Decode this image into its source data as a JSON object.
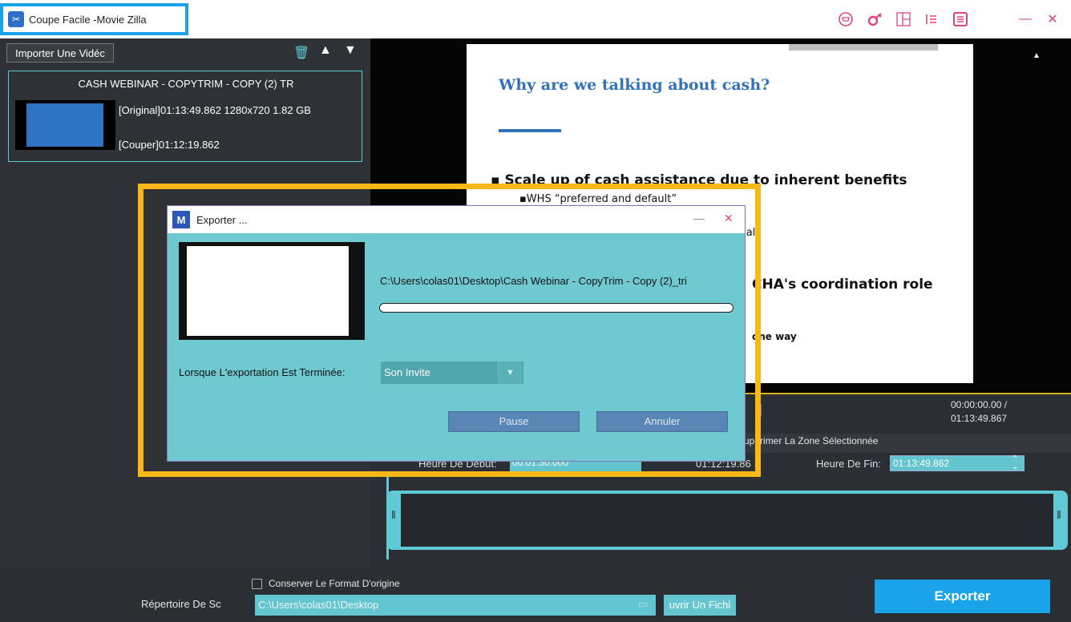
{
  "app": {
    "title": "Coupe Facile -Movie Zilla"
  },
  "toolbar": {
    "icons": [
      "cart-icon",
      "key-icon",
      "layout-icon",
      "settings-icon",
      "list-icon",
      "minimize-icon",
      "close-icon"
    ]
  },
  "left": {
    "import_label": "Importer Une Vidéc",
    "video": {
      "name": "CASH WEBINAR - COPYTRIM - COPY (2) TR",
      "original": "[Original]01:13:49.862 1280x720 1.82 GB",
      "couper": "[Couper]01:12:19.862"
    }
  },
  "preview": {
    "slide_title": "Why are we talking about cash?",
    "bullet1": "▪ Scale up of cash assistance due to inherent benefits",
    "sub1": "▪WHS “preferred and default”",
    "partial_tial": "tial",
    "partial_ocha": "CHA's coordination role",
    "partial_way": "one way"
  },
  "timeline": {
    "time_current": "00:00:00.00 /",
    "time_total": "01:13:49.867",
    "delete_zone": "Supprimer La Zone Sélectionnée",
    "start_label": "Heure De Début:",
    "start_value": "00:01:30.000",
    "duration": "01:12:19.86",
    "end_label": "Heure De Fin:",
    "end_value": "01:13:49.862"
  },
  "bottom": {
    "keep_format": "Conserver Le Format D'origine",
    "dir_label": "Répertoire De Sc",
    "dir_value": "C:\\Users\\colas01\\Desktop",
    "open_file": "uvrir Un Fichi",
    "export": "Exporter"
  },
  "dialog": {
    "title": "Exporter ...",
    "path": "C:\\Users\\colas01\\Desktop\\Cash Webinar - CopyTrim - Copy (2)_tri",
    "progress": 0,
    "when_label": "Lorsque L'exportation Est Terminée:",
    "when_value": "Son Invite",
    "pause": "Pause",
    "cancel": "Annuler"
  }
}
